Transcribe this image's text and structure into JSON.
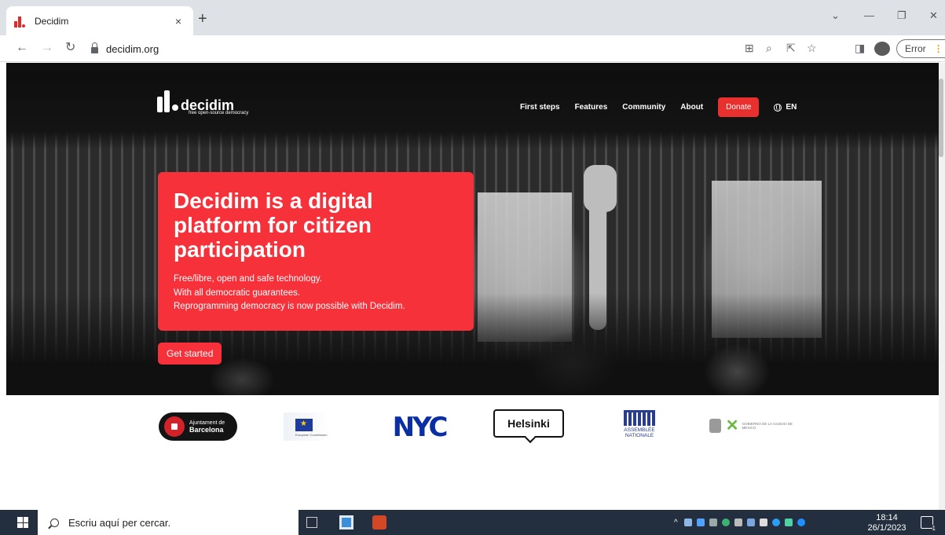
{
  "browser": {
    "tab_title": "Decidim",
    "tab_close": "×",
    "new_tab": "+",
    "url": "decidim.org",
    "error_label": "Error",
    "error_menu": "⋮"
  },
  "site": {
    "logo_text": "decidim",
    "logo_tagline": "free open-source democracy",
    "nav": [
      "First steps",
      "Features",
      "Community",
      "About"
    ],
    "donate_label": "Donate",
    "language": "EN",
    "hero_title": "Decidim is a digital platform for citizen participation",
    "hero_lines": [
      "Free/libre, open and safe technology.",
      "With all democratic guarantees.",
      "Reprogramming democracy is now possible with Decidim."
    ],
    "cta_label": "Get started"
  },
  "partners": {
    "barcelona_line1": "Ajuntament de",
    "barcelona_line2": "Barcelona",
    "eu_caption": "European Commission",
    "nyc": "NYC",
    "helsinki": "Helsinki",
    "assemblee_line1": "ASSEMBLÉE",
    "assemblee_line2": "NATIONALE",
    "cdmx_text": "GOBIERNO DE LA CIUDAD DE MÉXICO"
  },
  "taskbar": {
    "search_placeholder": "Escriu aquí per cercar.",
    "time": "18:14",
    "date": "26/1/2023",
    "notifications": "1"
  },
  "colors": {
    "brand_red": "#f7313a",
    "taskbar": "#232f3f"
  }
}
